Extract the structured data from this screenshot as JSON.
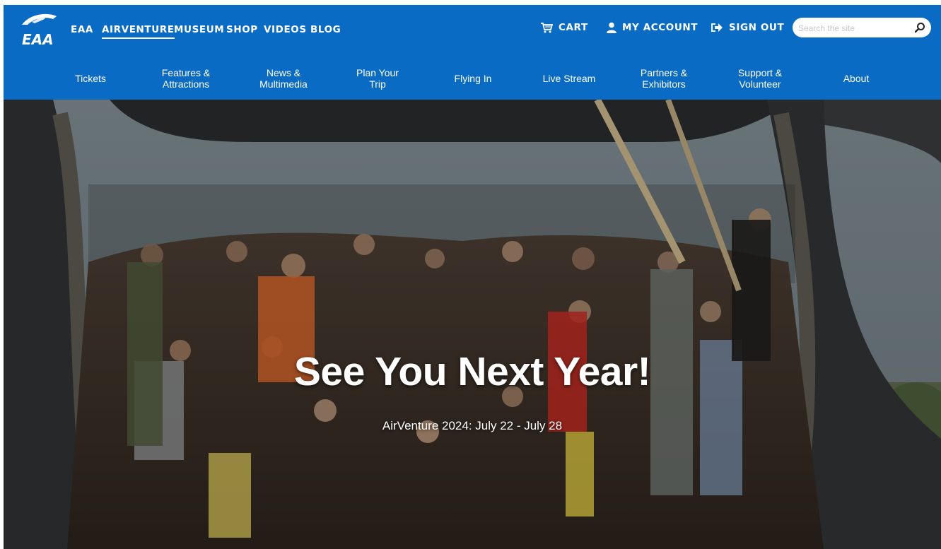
{
  "header": {
    "logo_text": "EAA",
    "top_links": [
      {
        "label": "EAA"
      },
      {
        "label": "AIRVENTURE",
        "active": true
      },
      {
        "label": "MUSEUM"
      },
      {
        "label": "SHOP"
      },
      {
        "label": "VIDEOS"
      },
      {
        "label": "BLOG"
      }
    ],
    "cart_label": "CART",
    "account_label": "MY ACCOUNT",
    "signout_label": "SIGN OUT",
    "search_placeholder": "Search the site",
    "bar_color": "#0a6bc4"
  },
  "nav": {
    "items": [
      {
        "label": "Tickets"
      },
      {
        "label": "Features &\nAttractions"
      },
      {
        "label": "News &\nMultimedia"
      },
      {
        "label": "Plan Your\nTrip"
      },
      {
        "label": "Flying In"
      },
      {
        "label": "Live Stream"
      },
      {
        "label": "Partners &\nExhibitors"
      },
      {
        "label": "Support &\nVolunteer"
      },
      {
        "label": "About"
      }
    ]
  },
  "hero": {
    "title": "See You Next Year!",
    "subtitle": "AirVenture 2024: July 22 - July 28"
  }
}
